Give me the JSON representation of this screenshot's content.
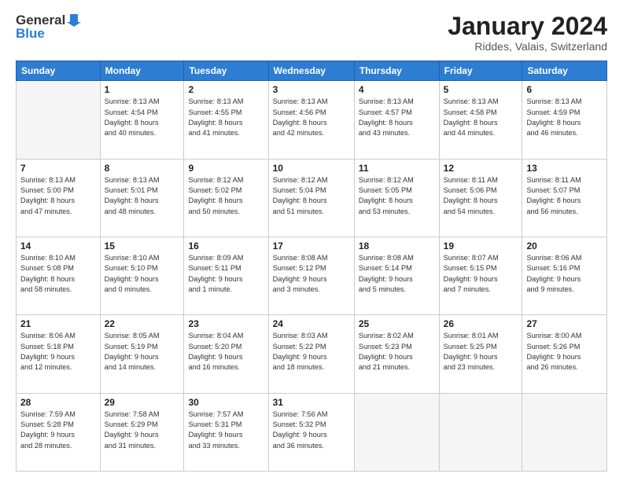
{
  "logo": {
    "general": "General",
    "blue": "Blue"
  },
  "header": {
    "month": "January 2024",
    "location": "Riddes, Valais, Switzerland"
  },
  "weekdays": [
    "Sunday",
    "Monday",
    "Tuesday",
    "Wednesday",
    "Thursday",
    "Friday",
    "Saturday"
  ],
  "weeks": [
    [
      {
        "day": "",
        "info": ""
      },
      {
        "day": "1",
        "info": "Sunrise: 8:13 AM\nSunset: 4:54 PM\nDaylight: 8 hours\nand 40 minutes."
      },
      {
        "day": "2",
        "info": "Sunrise: 8:13 AM\nSunset: 4:55 PM\nDaylight: 8 hours\nand 41 minutes."
      },
      {
        "day": "3",
        "info": "Sunrise: 8:13 AM\nSunset: 4:56 PM\nDaylight: 8 hours\nand 42 minutes."
      },
      {
        "day": "4",
        "info": "Sunrise: 8:13 AM\nSunset: 4:57 PM\nDaylight: 8 hours\nand 43 minutes."
      },
      {
        "day": "5",
        "info": "Sunrise: 8:13 AM\nSunset: 4:58 PM\nDaylight: 8 hours\nand 44 minutes."
      },
      {
        "day": "6",
        "info": "Sunrise: 8:13 AM\nSunset: 4:59 PM\nDaylight: 8 hours\nand 46 minutes."
      }
    ],
    [
      {
        "day": "7",
        "info": "Sunrise: 8:13 AM\nSunset: 5:00 PM\nDaylight: 8 hours\nand 47 minutes."
      },
      {
        "day": "8",
        "info": "Sunrise: 8:13 AM\nSunset: 5:01 PM\nDaylight: 8 hours\nand 48 minutes."
      },
      {
        "day": "9",
        "info": "Sunrise: 8:12 AM\nSunset: 5:02 PM\nDaylight: 8 hours\nand 50 minutes."
      },
      {
        "day": "10",
        "info": "Sunrise: 8:12 AM\nSunset: 5:04 PM\nDaylight: 8 hours\nand 51 minutes."
      },
      {
        "day": "11",
        "info": "Sunrise: 8:12 AM\nSunset: 5:05 PM\nDaylight: 8 hours\nand 53 minutes."
      },
      {
        "day": "12",
        "info": "Sunrise: 8:11 AM\nSunset: 5:06 PM\nDaylight: 8 hours\nand 54 minutes."
      },
      {
        "day": "13",
        "info": "Sunrise: 8:11 AM\nSunset: 5:07 PM\nDaylight: 8 hours\nand 56 minutes."
      }
    ],
    [
      {
        "day": "14",
        "info": "Sunrise: 8:10 AM\nSunset: 5:08 PM\nDaylight: 8 hours\nand 58 minutes."
      },
      {
        "day": "15",
        "info": "Sunrise: 8:10 AM\nSunset: 5:10 PM\nDaylight: 9 hours\nand 0 minutes."
      },
      {
        "day": "16",
        "info": "Sunrise: 8:09 AM\nSunset: 5:11 PM\nDaylight: 9 hours\nand 1 minute."
      },
      {
        "day": "17",
        "info": "Sunrise: 8:08 AM\nSunset: 5:12 PM\nDaylight: 9 hours\nand 3 minutes."
      },
      {
        "day": "18",
        "info": "Sunrise: 8:08 AM\nSunset: 5:14 PM\nDaylight: 9 hours\nand 5 minutes."
      },
      {
        "day": "19",
        "info": "Sunrise: 8:07 AM\nSunset: 5:15 PM\nDaylight: 9 hours\nand 7 minutes."
      },
      {
        "day": "20",
        "info": "Sunrise: 8:06 AM\nSunset: 5:16 PM\nDaylight: 9 hours\nand 9 minutes."
      }
    ],
    [
      {
        "day": "21",
        "info": "Sunrise: 8:06 AM\nSunset: 5:18 PM\nDaylight: 9 hours\nand 12 minutes."
      },
      {
        "day": "22",
        "info": "Sunrise: 8:05 AM\nSunset: 5:19 PM\nDaylight: 9 hours\nand 14 minutes."
      },
      {
        "day": "23",
        "info": "Sunrise: 8:04 AM\nSunset: 5:20 PM\nDaylight: 9 hours\nand 16 minutes."
      },
      {
        "day": "24",
        "info": "Sunrise: 8:03 AM\nSunset: 5:22 PM\nDaylight: 9 hours\nand 18 minutes."
      },
      {
        "day": "25",
        "info": "Sunrise: 8:02 AM\nSunset: 5:23 PM\nDaylight: 9 hours\nand 21 minutes."
      },
      {
        "day": "26",
        "info": "Sunrise: 8:01 AM\nSunset: 5:25 PM\nDaylight: 9 hours\nand 23 minutes."
      },
      {
        "day": "27",
        "info": "Sunrise: 8:00 AM\nSunset: 5:26 PM\nDaylight: 9 hours\nand 26 minutes."
      }
    ],
    [
      {
        "day": "28",
        "info": "Sunrise: 7:59 AM\nSunset: 5:28 PM\nDaylight: 9 hours\nand 28 minutes."
      },
      {
        "day": "29",
        "info": "Sunrise: 7:58 AM\nSunset: 5:29 PM\nDaylight: 9 hours\nand 31 minutes."
      },
      {
        "day": "30",
        "info": "Sunrise: 7:57 AM\nSunset: 5:31 PM\nDaylight: 9 hours\nand 33 minutes."
      },
      {
        "day": "31",
        "info": "Sunrise: 7:56 AM\nSunset: 5:32 PM\nDaylight: 9 hours\nand 36 minutes."
      },
      {
        "day": "",
        "info": ""
      },
      {
        "day": "",
        "info": ""
      },
      {
        "day": "",
        "info": ""
      }
    ]
  ]
}
